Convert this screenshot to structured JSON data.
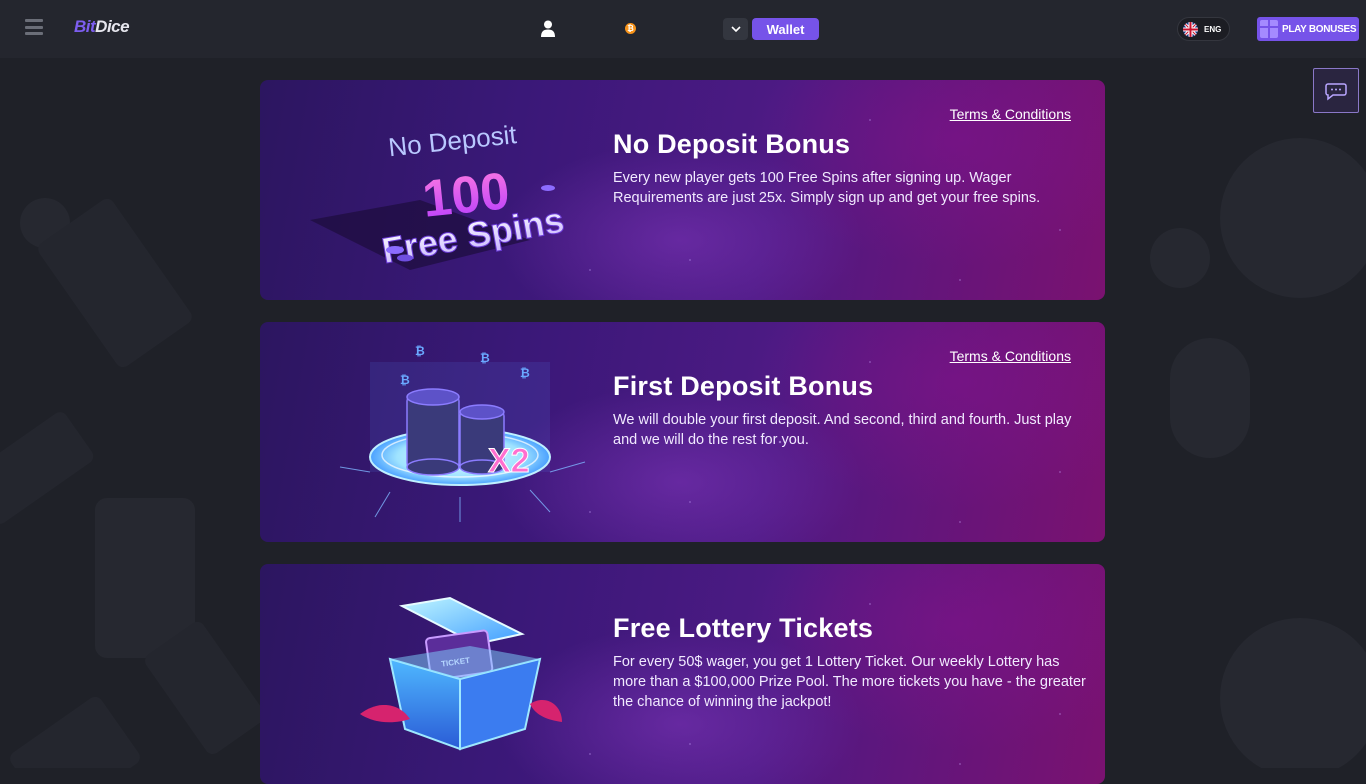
{
  "header": {
    "logo_part1": "Bit",
    "logo_part2": "Dice",
    "wallet_label": "Wallet",
    "language": "ENG",
    "play_bonuses_label": "PLAY BONUSES"
  },
  "cards": [
    {
      "terms_label": "Terms & Conditions",
      "title": "No Deposit Bonus",
      "description": "Every new player gets 100 Free Spins after signing up. Wager Requirements are just 25x. Simply sign up and get your free spins.",
      "art": {
        "line1": "No Deposit",
        "number": "100",
        "line2": "Free Spins"
      }
    },
    {
      "terms_label": "Terms & Conditions",
      "title": "First Deposit Bonus",
      "description": "We will double your first deposit. And second, third and fourth. Just play and we will do the rest for you.",
      "art": {
        "multiplier": "X2"
      }
    },
    {
      "title": "Free Lottery Tickets",
      "description": "For every 50$ wager, you get 1 Lottery Ticket. Our weekly Lottery has more than a $100,000 Prize Pool. The more tickets you have - the greater the chance of winning the jackpot!",
      "art": {
        "ticket": "TICKET"
      }
    }
  ],
  "colors": {
    "accent": "#7653e9",
    "background": "#1f2128",
    "topbar": "#24262e"
  }
}
